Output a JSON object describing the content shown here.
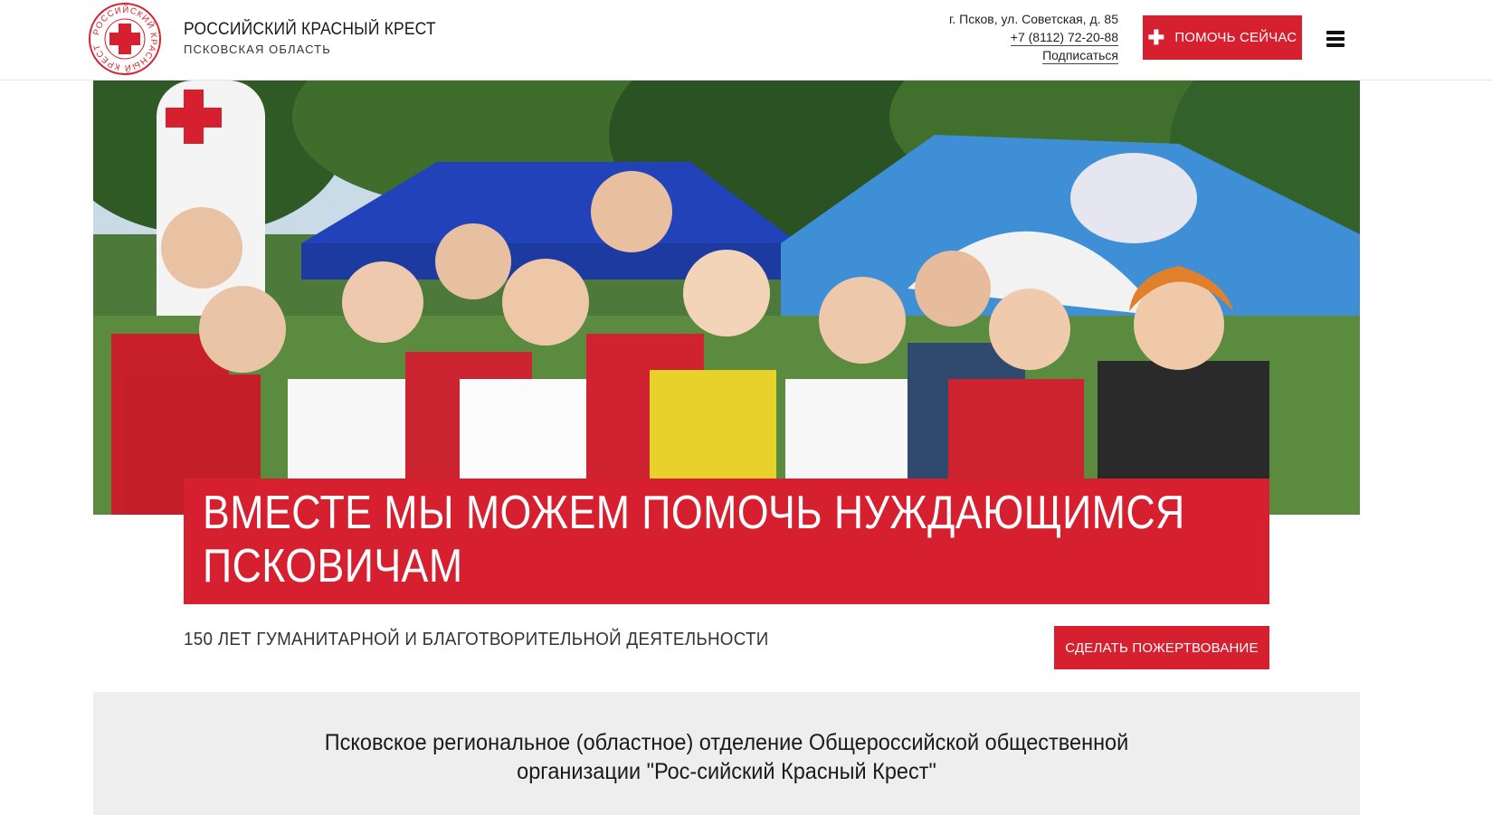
{
  "header": {
    "brand_title": "РОССИЙСКИЙ КРАСНЫЙ КРЕСТ",
    "brand_subtitle": "ПСКОВСКАЯ ОБЛАСТЬ",
    "logo_ring_text": "РОССИЙСКИЙ КРАСНЫЙ КРЕСТ",
    "address": "г. Псков, ул. Советская, д. 85",
    "phone": "+7 (8112) 72-20-88",
    "subscribe_label": "Подписаться",
    "help_now_label": "ПОМОЧЬ СЕЙЧАС",
    "help_icon": "plus-icon",
    "menu_icon": "hamburger-menu-icon"
  },
  "hero": {
    "image": "volunteers-group-photo"
  },
  "headline": {
    "text": "ВМЕСТЕ МЫ МОЖЕМ ПОМОЧЬ НУЖДАЮЩИМСЯ ПСКОВИЧАМ"
  },
  "tagline": {
    "text": "150 ЛЕТ ГУМАНИТАРНОЙ И БЛАГОТВОРИТЕЛЬНОЙ ДЕЯТЕЛЬНОСТИ",
    "donate_label": "СДЕЛАТЬ ПОЖЕРТВОВАНИЕ"
  },
  "info": {
    "text": "Псковское региональное (областное) отделение Общероссийской общественной организации \"Рос-сийский Красный Крест\""
  },
  "colors": {
    "brand_red": "#d7202f",
    "info_bg": "#eeeeee"
  }
}
